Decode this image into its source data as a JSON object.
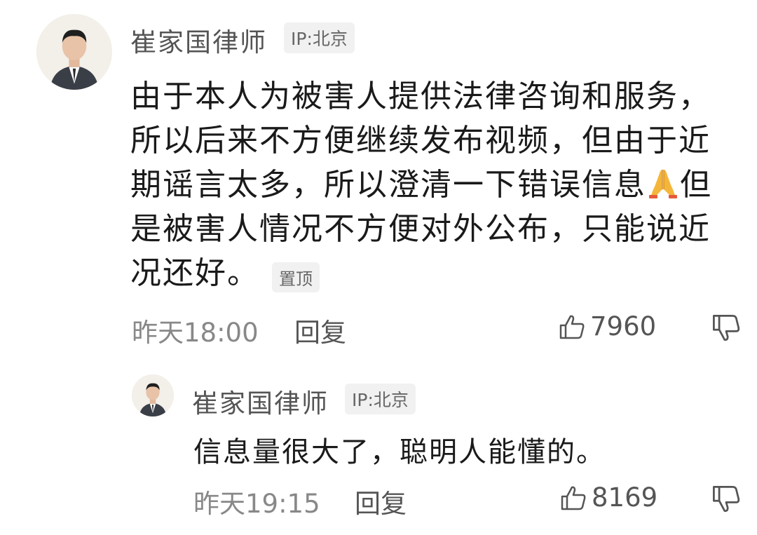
{
  "comment": {
    "author": "崔家国律师",
    "ip": "IP:北京",
    "lines": [
      "由于本人为被害人提供法律咨询和服务，",
      "所以后来不方便继续发布视频，但由于近",
      "期谣言太多，所以澄清一下错误信息",
      "是被害人情况不方便对外公布，只能说近",
      "况还好。"
    ],
    "line3_tail": "但",
    "pin_label": "置顶",
    "time": "昨天18:00",
    "reply_label": "回复",
    "likes": "7960"
  },
  "reply": {
    "author": "崔家国律师",
    "ip": "IP:北京",
    "text": "信息量很大了，聪明人能懂的。",
    "time": "昨天19:15",
    "reply_label": "回复",
    "likes": "8169"
  },
  "icons": {
    "like": "thumbs-up-icon",
    "dislike": "thumbs-down-icon",
    "emoji": "folded-hands-emoji"
  }
}
